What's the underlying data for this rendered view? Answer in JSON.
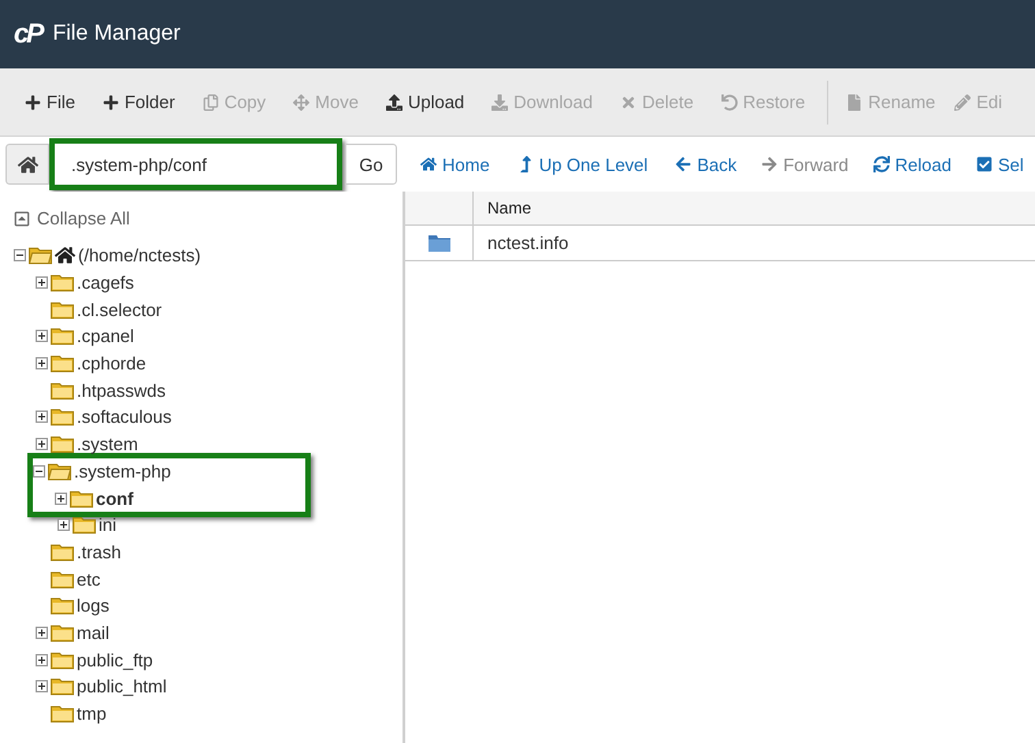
{
  "header": {
    "logo": "cP",
    "title": "File Manager"
  },
  "toolbar": [
    {
      "label": "File",
      "kind": "new-file",
      "disabled": false
    },
    {
      "label": "Folder",
      "kind": "new-folder",
      "disabled": false
    },
    {
      "label": "Copy",
      "kind": "copy",
      "disabled": true
    },
    {
      "label": "Move",
      "kind": "move",
      "disabled": true
    },
    {
      "label": "Upload",
      "kind": "upload",
      "disabled": false
    },
    {
      "label": "Download",
      "kind": "download",
      "disabled": true
    },
    {
      "label": "Delete",
      "kind": "delete",
      "disabled": true
    },
    {
      "label": "Restore",
      "kind": "restore",
      "disabled": true
    },
    {
      "label": "Rename",
      "kind": "rename",
      "disabled": true,
      "separated": true
    },
    {
      "label": "Edi",
      "kind": "edit",
      "disabled": true
    }
  ],
  "path_bar": {
    "value": ".system-php/conf",
    "highlighted": true,
    "go": "Go"
  },
  "nav": [
    {
      "label": "Home",
      "kind": "home",
      "disabled": false
    },
    {
      "label": "Up One Level",
      "kind": "up",
      "disabled": false
    },
    {
      "label": "Back",
      "kind": "back",
      "disabled": false
    },
    {
      "label": "Forward",
      "kind": "forward",
      "disabled": true
    },
    {
      "label": "Reload",
      "kind": "reload",
      "disabled": false
    },
    {
      "label": "Sel",
      "kind": "select",
      "disabled": false
    }
  ],
  "collapse_all": "Collapse All",
  "tree": {
    "label": "(/home/nctests)",
    "kind": "branch",
    "expanded": true,
    "selected": false,
    "highlighted": false,
    "children": [
      {
        "label": ".cagefs",
        "kind": "branch",
        "expanded": false,
        "selected": false,
        "highlighted": false
      },
      {
        "label": ".cl.selector",
        "kind": "leaf",
        "expanded": false,
        "selected": false,
        "highlighted": false
      },
      {
        "label": ".cpanel",
        "kind": "branch",
        "expanded": false,
        "selected": false,
        "highlighted": false
      },
      {
        "label": ".cphorde",
        "kind": "branch",
        "expanded": false,
        "selected": false,
        "highlighted": false
      },
      {
        "label": ".htpasswds",
        "kind": "leaf",
        "expanded": false,
        "selected": false,
        "highlighted": false
      },
      {
        "label": ".softaculous",
        "kind": "branch",
        "expanded": false,
        "selected": false,
        "highlighted": false
      },
      {
        "label": ".system",
        "kind": "branch",
        "expanded": false,
        "selected": false,
        "highlighted": false
      },
      {
        "label": ".system-php",
        "kind": "branch",
        "expanded": true,
        "selected": false,
        "highlighted": true,
        "children": [
          {
            "label": "conf",
            "kind": "branch",
            "expanded": false,
            "selected": true,
            "highlighted": true
          },
          {
            "label": "ini",
            "kind": "branch",
            "expanded": false,
            "selected": false,
            "highlighted": false
          }
        ]
      },
      {
        "label": ".trash",
        "kind": "leaf",
        "expanded": false,
        "selected": false,
        "highlighted": false
      },
      {
        "label": "etc",
        "kind": "leaf",
        "expanded": false,
        "selected": false,
        "highlighted": false
      },
      {
        "label": "logs",
        "kind": "leaf",
        "expanded": false,
        "selected": false,
        "highlighted": false
      },
      {
        "label": "mail",
        "kind": "branch",
        "expanded": false,
        "selected": false,
        "highlighted": false
      },
      {
        "label": "public_ftp",
        "kind": "branch",
        "expanded": false,
        "selected": false,
        "highlighted": false
      },
      {
        "label": "public_html",
        "kind": "branch",
        "expanded": false,
        "selected": false,
        "highlighted": false
      },
      {
        "label": "tmp",
        "kind": "leaf",
        "expanded": false,
        "selected": false,
        "highlighted": false
      }
    ]
  },
  "table": {
    "columns": [
      "Name"
    ],
    "rows": [
      {
        "name": "nctest.info"
      }
    ]
  }
}
